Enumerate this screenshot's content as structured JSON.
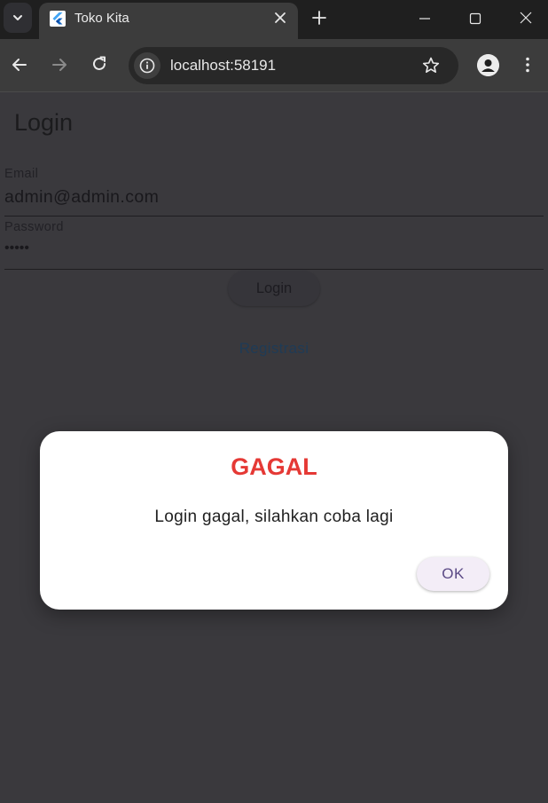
{
  "browser": {
    "tab_title": "Toko Kita",
    "url": "localhost:58191"
  },
  "page": {
    "title": "Login",
    "email": {
      "label": "Email",
      "value": "admin@admin.com"
    },
    "password": {
      "label": "Password",
      "value": "•••••"
    },
    "login_button": "Login",
    "register_link": "Registrasi"
  },
  "dialog": {
    "title": "GAGAL",
    "message": "Login gagal, silahkan coba lagi",
    "ok_button": "OK",
    "title_color": "#e53935"
  },
  "icons": [
    "tab-search-icon",
    "flutter-icon",
    "close-icon",
    "plus-icon",
    "minimize-icon",
    "maximize-icon",
    "window-close-icon",
    "back-arrow-icon",
    "forward-arrow-icon",
    "reload-icon",
    "info-icon",
    "star-icon",
    "profile-icon",
    "kebab-menu-icon"
  ]
}
